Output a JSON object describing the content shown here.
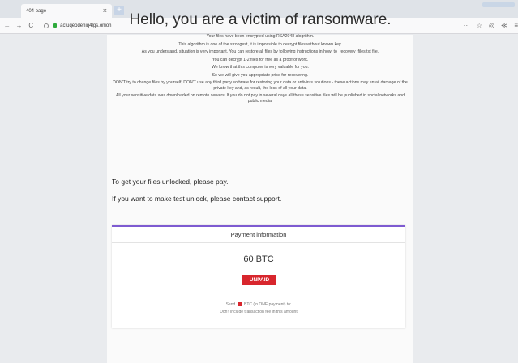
{
  "browser": {
    "tab_title": "404 page",
    "tab_close": "×",
    "new_tab": "+",
    "nav_back": "←",
    "nav_forward": "→",
    "nav_reload": "C",
    "url": "actuqeodeniq4lgs.onion",
    "toolbar_icons": [
      "···",
      "☆",
      "◎",
      "≪",
      "≡"
    ]
  },
  "page": {
    "headline": "Hello, you are a victim of ransomware.",
    "message_lines": [
      "Your files have been encrypted using RSA2048 alogrithm.",
      "This algorithm is one of the strongest, it is impossible to decrypt files without known key.",
      "As you understand, situation is very important. You can restore all files by following instructions in how_to_recovery_files.txt file.",
      "You can decrypt 1-2 files for free as a proof of work.",
      "We know that this computer is very valuable for you.",
      "So we will give you appropriate price for recovering.",
      "DON'T try to change files by yourself, DON'T use any third party software for restoring your data or antivirus solutions - these actions may entail damage of the private key and, as result, the loss of all your data.",
      "All your sensitive data was downloaded on remote servers. If you do not pay in several days all these sensitive files will be published in social networks and public media."
    ],
    "pay_instruction": "To get your files unlocked, please pay.",
    "test_unlock": "If you want to make test unlock, please contact support."
  },
  "payment": {
    "header": "Payment information",
    "amount": "60 BTC",
    "status": "UNPAID",
    "note_prefix": "Send ",
    "note_suffix": " BTC (in ONE payment) to:",
    "note_line2": "Don't include transaction fee in this amount"
  },
  "colors": {
    "accent": "#7e5bd1",
    "unpaid": "#d8262d"
  }
}
